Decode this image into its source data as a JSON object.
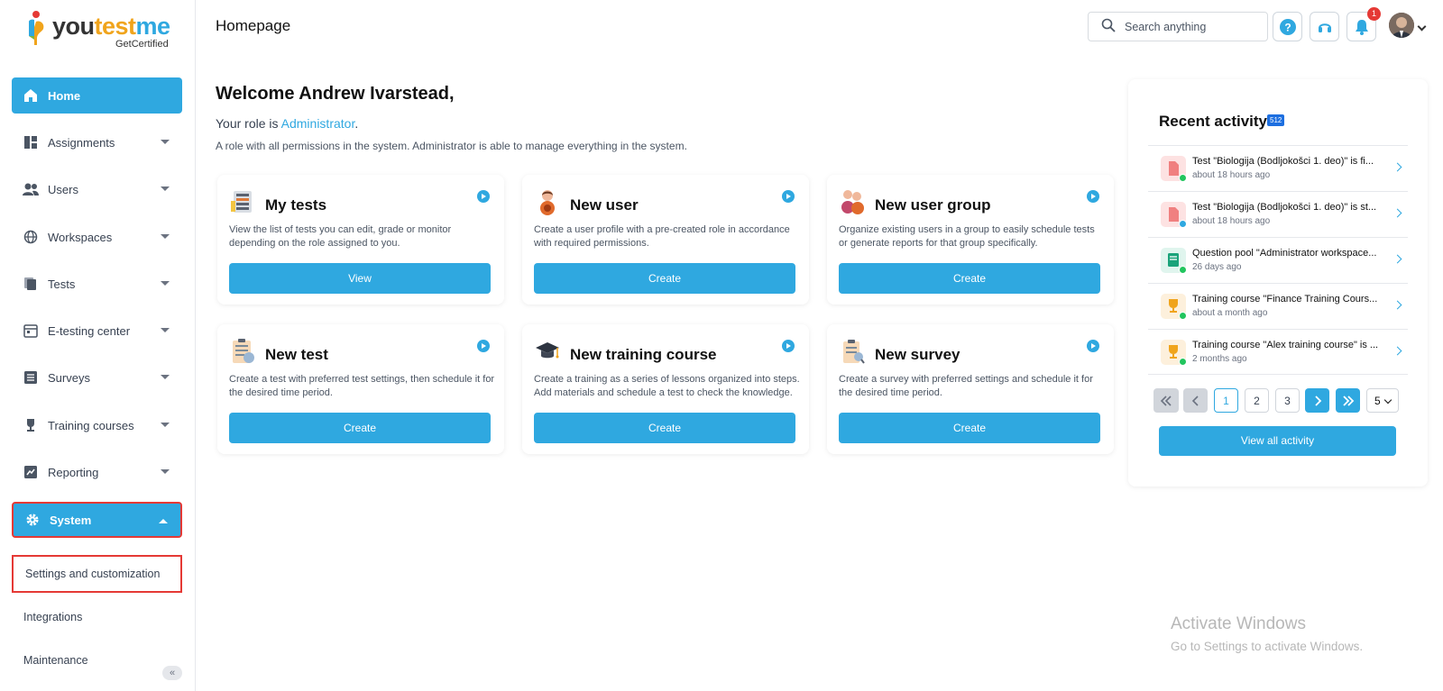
{
  "brand": {
    "part1": "you",
    "part2": "test",
    "part3": "me",
    "sub": "GetCertified"
  },
  "sidebar": {
    "items": [
      {
        "label": "Home"
      },
      {
        "label": "Assignments"
      },
      {
        "label": "Users"
      },
      {
        "label": "Workspaces"
      },
      {
        "label": "Tests"
      },
      {
        "label": "E-testing center"
      },
      {
        "label": "Surveys"
      },
      {
        "label": "Training courses"
      },
      {
        "label": "Reporting"
      },
      {
        "label": "System"
      }
    ],
    "subitems": [
      {
        "label": "Settings and customization"
      },
      {
        "label": "Integrations"
      },
      {
        "label": "Maintenance"
      }
    ],
    "collapse_glyph": "«"
  },
  "header": {
    "title": "Homepage",
    "search_placeholder": "Search anything",
    "notification_count": "1"
  },
  "welcome": {
    "greeting": "Welcome Andrew Ivarstead,",
    "role_prefix": "Your role is ",
    "role": "Administrator",
    "role_suffix": ".",
    "role_desc": "A role with all permissions in the system. Administrator is able to manage everything in the system."
  },
  "cards": [
    {
      "title": "My tests",
      "desc": "View the list of tests you can edit, grade or monitor depending on the role assigned to you.",
      "button": "View"
    },
    {
      "title": "New user",
      "desc": "Create a user profile with a pre-created role in accordance with required permissions.",
      "button": "Create"
    },
    {
      "title": "New user group",
      "desc": "Organize existing users in a group to easily schedule tests or generate reports for that group specifically.",
      "button": "Create"
    },
    {
      "title": "New test",
      "desc": "Create a test with preferred test settings, then schedule it for the desired time period.",
      "button": "Create"
    },
    {
      "title": "New training course",
      "desc": "Create a training as a series of lessons organized into steps. Add materials and schedule a test to check the knowledge.",
      "button": "Create"
    },
    {
      "title": "New survey",
      "desc": "Create a survey with preferred settings and schedule it for the desired time period.",
      "button": "Create"
    }
  ],
  "activity": {
    "title": "Recent activity",
    "count": "512",
    "items": [
      {
        "text": "Test \"Biologija (Bodljokošci 1. deo)\" is fi...",
        "time": "about 18 hours ago"
      },
      {
        "text": "Test \"Biologija (Bodljokošci 1. deo)\" is st...",
        "time": "about 18 hours ago"
      },
      {
        "text": "Question pool \"Administrator workspace...",
        "time": "26 days ago"
      },
      {
        "text": "Training course \"Finance Training Cours...",
        "time": "about a month ago"
      },
      {
        "text": "Training course \"Alex training course\" is ...",
        "time": "2 months ago"
      }
    ],
    "pages": [
      "1",
      "2",
      "3"
    ],
    "page_size": "5",
    "view_all": "View all activity"
  },
  "watermark": {
    "line1": "Activate Windows",
    "line2": "Go to Settings to activate Windows."
  },
  "colors": {
    "accent": "#2fa8e0",
    "highlight_border": "#e53935"
  }
}
